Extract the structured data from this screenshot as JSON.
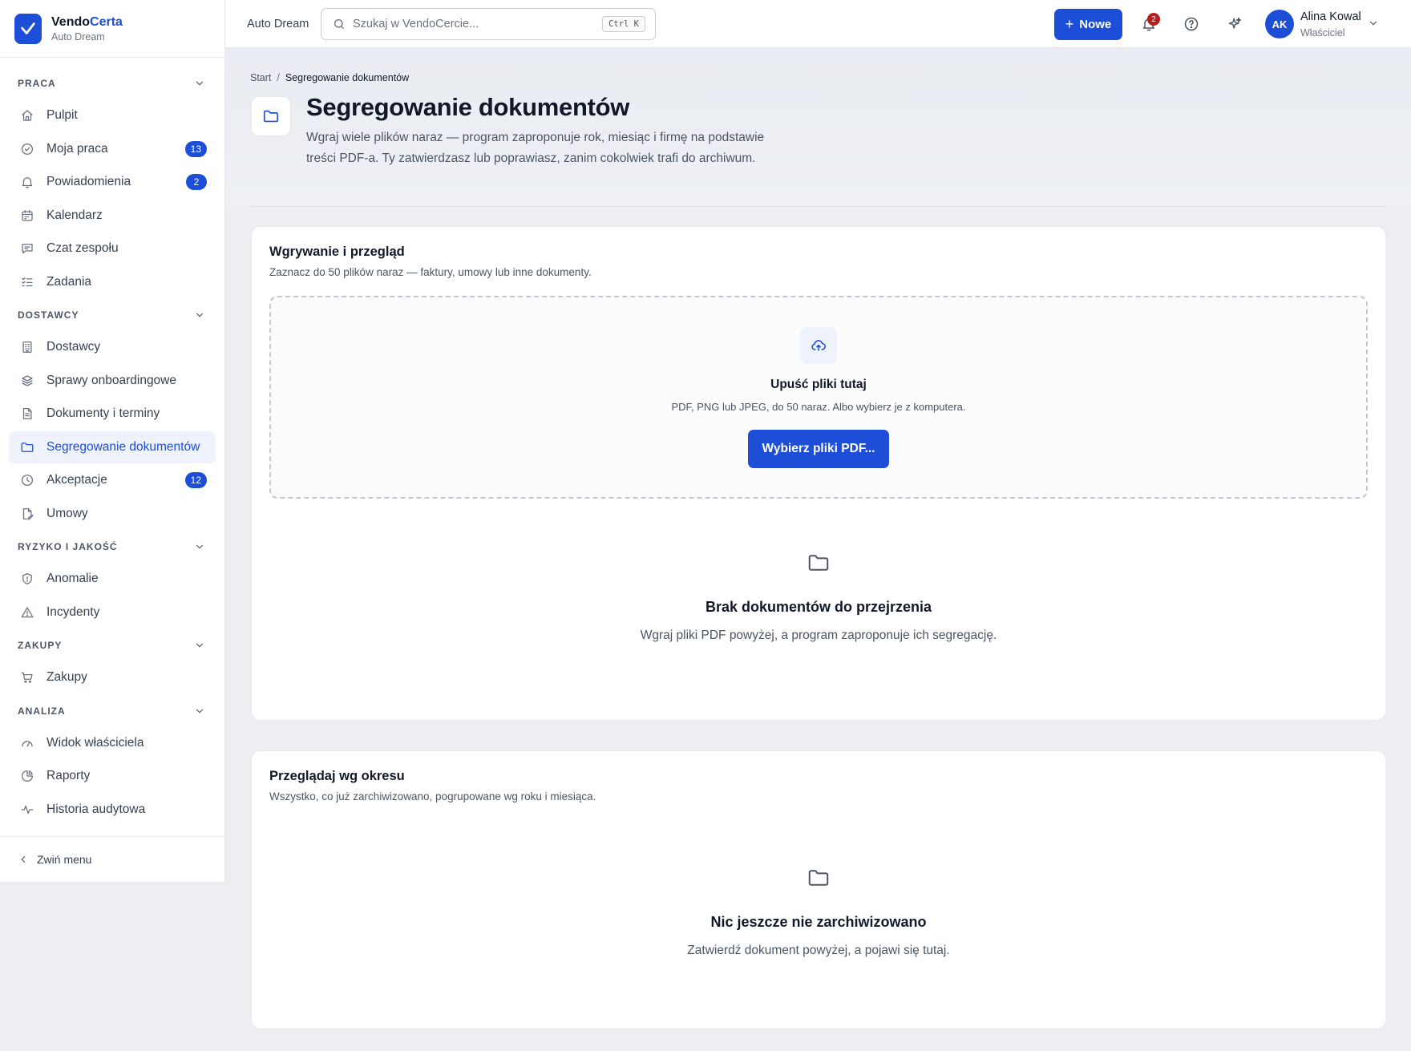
{
  "brand": {
    "name_part1": "Vendo",
    "name_part2": "Certa",
    "org": "Auto Dream"
  },
  "sidebar": {
    "sections": [
      {
        "title": "PRACA",
        "items": [
          {
            "label": "Pulpit",
            "icon": "home-icon"
          },
          {
            "label": "Moja praca",
            "icon": "check-circle-icon",
            "badge": "13"
          },
          {
            "label": "Powiadomienia",
            "icon": "bell-icon",
            "badge": "2"
          },
          {
            "label": "Kalendarz",
            "icon": "calendar-icon"
          },
          {
            "label": "Czat zespołu",
            "icon": "chat-icon"
          },
          {
            "label": "Zadania",
            "icon": "list-checks-icon"
          }
        ]
      },
      {
        "title": "DOSTAWCY",
        "items": [
          {
            "label": "Dostawcy",
            "icon": "building-icon"
          },
          {
            "label": "Sprawy onboardingowe",
            "icon": "layers-icon"
          },
          {
            "label": "Dokumenty i terminy",
            "icon": "file-icon"
          },
          {
            "label": "Segregowanie dokumentów",
            "icon": "folder-icon",
            "active": true
          },
          {
            "label": "Akceptacje",
            "icon": "clock-icon",
            "badge": "12"
          },
          {
            "label": "Umowy",
            "icon": "contract-icon"
          }
        ]
      },
      {
        "title": "RYZYKO I JAKOŚĆ",
        "items": [
          {
            "label": "Anomalie",
            "icon": "shield-icon"
          },
          {
            "label": "Incydenty",
            "icon": "warning-icon"
          }
        ]
      },
      {
        "title": "ZAKUPY",
        "items": [
          {
            "label": "Zakupy",
            "icon": "cart-icon"
          }
        ]
      },
      {
        "title": "ANALIZA",
        "items": [
          {
            "label": "Widok właściciela",
            "icon": "gauge-icon"
          },
          {
            "label": "Raporty",
            "icon": "pie-chart-icon"
          },
          {
            "label": "Historia audytowa",
            "icon": "activity-icon"
          }
        ]
      }
    ],
    "collapse_label": "Zwiń menu"
  },
  "topbar": {
    "org": "Auto Dream",
    "search_placeholder": "Szukaj w VendoCercie...",
    "search_shortcut": "Ctrl K",
    "new_label": "Nowe",
    "notif_count": "2",
    "user": {
      "initials": "AK",
      "name": "Alina Kowal",
      "role": "Właściciel"
    }
  },
  "page": {
    "breadcrumb": {
      "home": "Start",
      "current": "Segregowanie dokumentów"
    },
    "title": "Segregowanie dokumentów",
    "description": "Wgraj wiele plików naraz — program zaproponuje rok, miesiąc i firmę na podstawie treści PDF-a. Ty zatwierdzasz lub poprawiasz, zanim cokolwiek trafi do archiwum."
  },
  "upload": {
    "title": "Wgrywanie i przegląd",
    "subtitle": "Zaznacz do 50 plików naraz — faktury, umowy lub inne dokumenty.",
    "drop_title": "Upuść pliki tutaj",
    "drop_hint": "PDF, PNG lub JPEG, do 50 naraz. Albo wybierz je z komputera.",
    "choose_button": "Wybierz pliki PDF...",
    "empty_title": "Brak dokumentów do przejrzenia",
    "empty_text": "Wgraj pliki PDF powyżej, a program zaproponuje ich segregację."
  },
  "browse": {
    "title": "Przeglądaj wg okresu",
    "subtitle": "Wszystko, co już zarchiwizowano, pogrupowane wg roku i miesiąca.",
    "empty_title": "Nic jeszcze nie zarchiwizowano",
    "empty_text": "Zatwierdź dokument powyżej, a pojawi się tutaj."
  },
  "colors": {
    "accent": "#1d4ed8",
    "danger": "#b91c1c"
  }
}
